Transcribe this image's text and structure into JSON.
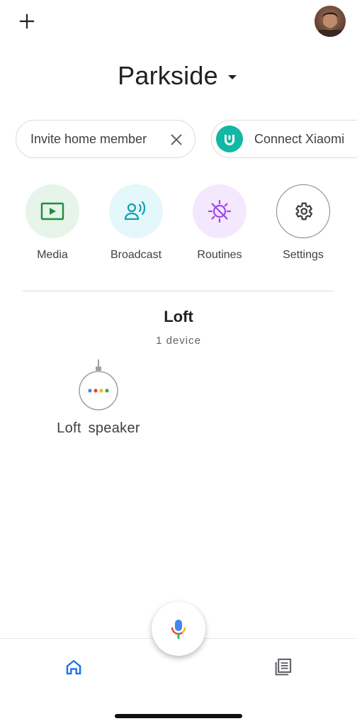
{
  "header": {
    "add_icon": "plus-icon",
    "avatar_icon": "account-avatar"
  },
  "home": {
    "title": "Parkside",
    "caret_icon": "caret-down-icon"
  },
  "chips": [
    {
      "label": "Invite home member",
      "action_icon": "close-icon"
    },
    {
      "label": "Connect Xiaomi",
      "icon": "mi-home-logo",
      "icon_color": "#10b8a5"
    }
  ],
  "quick_actions": [
    {
      "label": "Media",
      "icon": "media-play-icon",
      "color": "#1e8e3e"
    },
    {
      "label": "Broadcast",
      "icon": "broadcast-icon",
      "color": "#129eaf"
    },
    {
      "label": "Routines",
      "icon": "routines-icon",
      "color": "#a142f4"
    },
    {
      "label": "Settings",
      "icon": "gear-icon",
      "color": "#3c4043"
    }
  ],
  "room": {
    "title": "Loft",
    "subtitle": "1 device",
    "devices": [
      {
        "label": "Loft speaker",
        "icon": "smart-speaker-icon"
      }
    ]
  },
  "bottom_nav": {
    "items": [
      {
        "name": "home",
        "icon": "home-icon",
        "active": true
      },
      {
        "name": "feed",
        "icon": "feed-icon",
        "active": false
      }
    ],
    "mic_icon": "microphone-icon"
  },
  "colors": {
    "accent": "#1a73e8",
    "google_blue": "#4285f4",
    "google_red": "#ea4335",
    "google_yellow": "#fbbc04",
    "google_green": "#34a853"
  }
}
